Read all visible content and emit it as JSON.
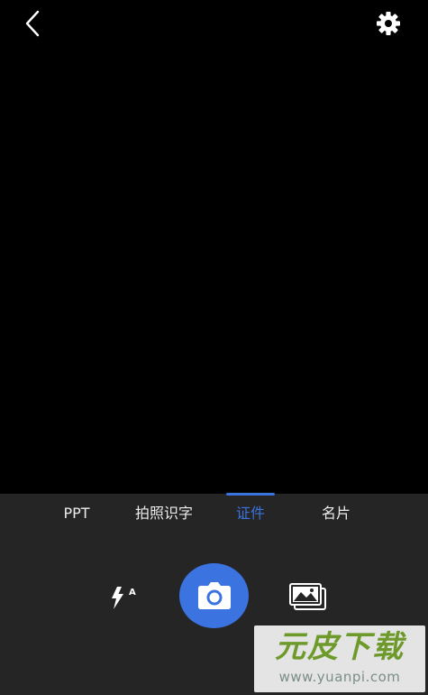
{
  "top_bar": {
    "back_icon": "chevron-left-icon",
    "settings_icon": "gear-icon"
  },
  "mode_tabs": {
    "items": [
      {
        "label": "PPT",
        "active": false
      },
      {
        "label": "拍照识字",
        "active": false
      },
      {
        "label": "证件",
        "active": true
      },
      {
        "label": "名片",
        "active": false
      }
    ]
  },
  "controls": {
    "flash_icon": "flash-auto-icon",
    "flash_badge": "A",
    "shutter_icon": "camera-icon",
    "gallery_icon": "gallery-icon"
  },
  "watermark": {
    "logo_text": "元皮下载",
    "url": "www.yuanpi.com"
  },
  "colors": {
    "accent": "#3b73e0",
    "panel_bg": "#252525",
    "viewfinder_bg": "#000000",
    "tab_text": "#ededed"
  }
}
